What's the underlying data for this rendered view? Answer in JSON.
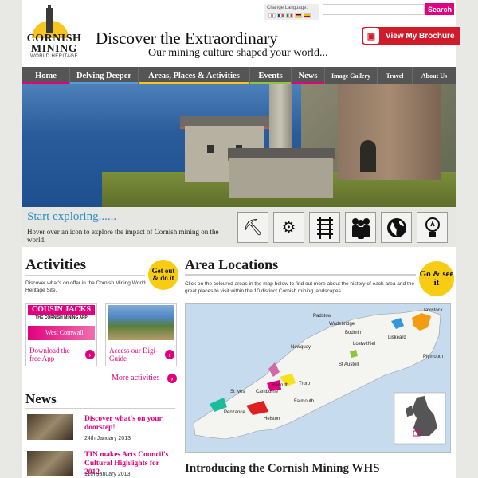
{
  "header": {
    "logo_line1": "CORNISH",
    "logo_line2": "MINING",
    "logo_line3": "WORLD HERITAGE",
    "change_language_label": "Change Language:",
    "flags": [
      "en",
      "fr",
      "it",
      "de",
      "es"
    ],
    "search_placeholder": "",
    "search_button": "Search",
    "tagline": "Discover the Extraordinary",
    "subtagline": "Our mining culture shaped your world...",
    "brochure_button": "View My Brochure"
  },
  "nav": {
    "items": [
      {
        "label": "Home",
        "accent": "#e3007e"
      },
      {
        "label": "Delving Deeper",
        "accent": "#5a9ad6"
      },
      {
        "label": "Areas, Places & Activities",
        "accent": "#f7c51e"
      },
      {
        "label": "Events",
        "accent": "#8cc63f"
      },
      {
        "label": "News",
        "accent": "#e3007e"
      },
      {
        "label": "Image Gallery",
        "accent": "#555555"
      },
      {
        "label": "Travel",
        "accent": "#555555"
      },
      {
        "label": "About Us",
        "accent": "#555555"
      }
    ]
  },
  "explore": {
    "title": "Start exploring......",
    "text": "Hover over an icon to explore the impact of Cornish mining on the world.",
    "icons": [
      "pickaxe-icon",
      "gears-icon",
      "railway-track-icon",
      "people-icon",
      "globe-icon",
      "lightbulb-icon"
    ]
  },
  "activities": {
    "heading": "Activities",
    "badge": "Get out & do it",
    "text": "Discover what's on offer in the Cornish Mining World Heritage Site.",
    "cards": [
      {
        "caption": "Download the free App",
        "app_title": "COUSIN JACKS",
        "app_sub": "THE CORNISH MINING APP",
        "app_place": "West Cornwall"
      },
      {
        "caption": "Access our Digi-Guide"
      }
    ],
    "more_link": "More activities"
  },
  "news": {
    "heading": "News",
    "items": [
      {
        "title": "Discover what's on your doorstep!",
        "date": "24th January 2013"
      },
      {
        "title": "TIN makes Arts Council's Cultural Highlights for 2012",
        "date": "11th January 2013"
      }
    ]
  },
  "area": {
    "heading": "Area Locations",
    "badge": "Go & see it",
    "text": "Click on the coloured areas in the map below to find out more about the history of each area and the great places to visit within the 10 distinct Cornish mining landscapes.",
    "map_labels": [
      "Tavistock",
      "Padstow",
      "Wadebridge",
      "Bodmin",
      "Liskeard",
      "Lostwithiel",
      "Newquay",
      "St Austell",
      "Plymouth",
      "Truro",
      "Redruth",
      "Camborne",
      "St Ives",
      "Falmouth",
      "Penzance",
      "Helston"
    ]
  },
  "intro_heading": "Introducing the Cornish Mining WHS",
  "colors": {
    "pink": "#e3007e",
    "nav_bg": "#555555",
    "yellow": "#f7cc12",
    "blue": "#2a8ec7"
  }
}
